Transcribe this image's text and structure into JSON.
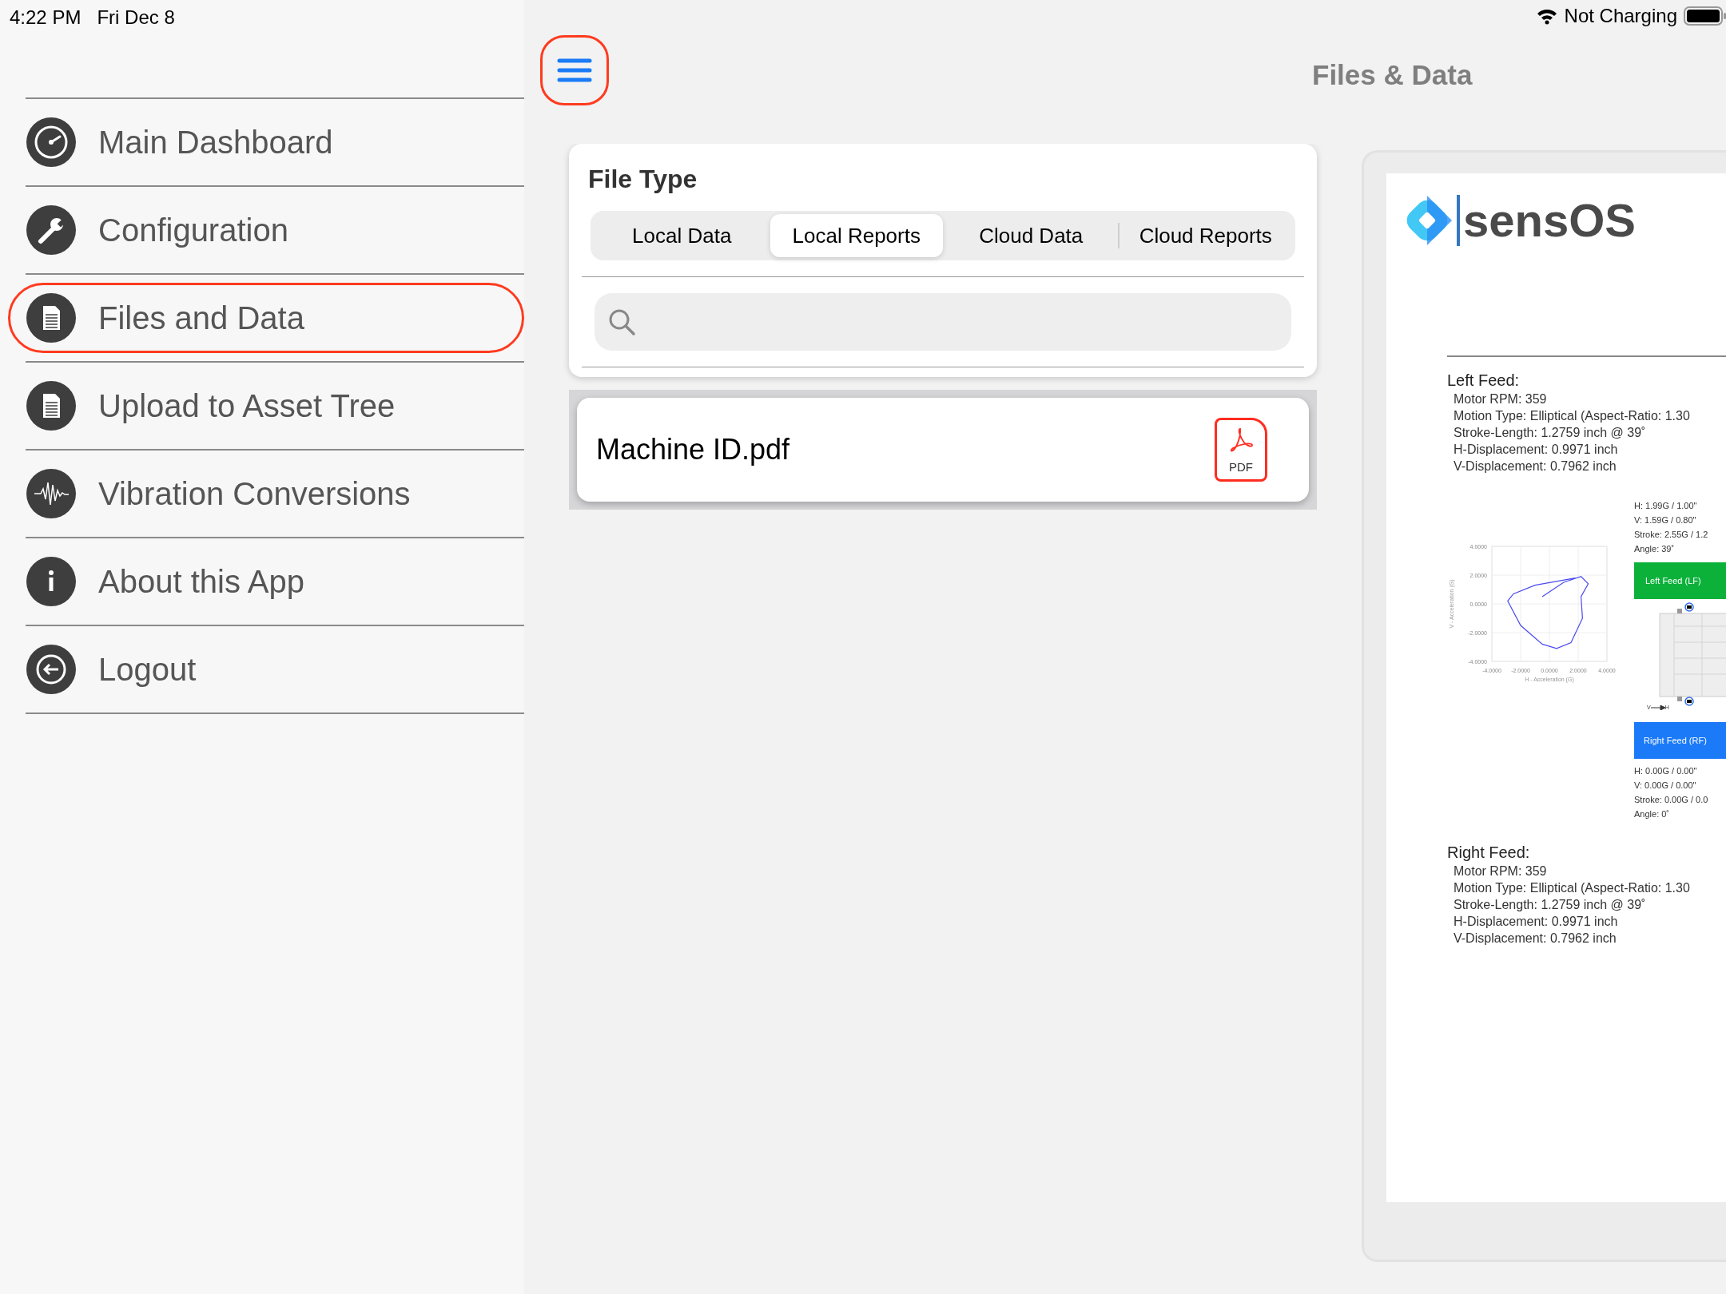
{
  "status_bar": {
    "time": "4:22 PM",
    "date": "Fri Dec 8",
    "battery_text": "Not Charging"
  },
  "sidebar": {
    "items": [
      {
        "label": "Main Dashboard",
        "kind": "gauge",
        "selected": false
      },
      {
        "label": "Configuration",
        "kind": "wrench",
        "selected": false
      },
      {
        "label": "Files and Data",
        "kind": "file",
        "selected": true
      },
      {
        "label": "Upload to Asset Tree",
        "kind": "file",
        "selected": false
      },
      {
        "label": "Vibration Conversions",
        "kind": "wave",
        "selected": false
      },
      {
        "label": "About this App",
        "kind": "info",
        "selected": false
      },
      {
        "label": "Logout",
        "kind": "logout",
        "selected": false
      }
    ]
  },
  "header": {
    "menu_button": {
      "highlighted": true
    },
    "title": "Files & Data"
  },
  "file_type": {
    "title": "File Type",
    "tabs": [
      {
        "label": "Local Data",
        "selected": false
      },
      {
        "label": "Local Reports",
        "selected": true
      },
      {
        "label": "Cloud Data",
        "selected": false
      },
      {
        "label": "Cloud Reports",
        "selected": false
      }
    ]
  },
  "files": [
    {
      "name": "Machine ID.pdf",
      "type_label": "PDF"
    }
  ],
  "preview": {
    "logo_text": "sensOS",
    "left_feed": {
      "heading": "Left Feed:",
      "lines": [
        "Motor RPM: 359",
        "Motion Type: Elliptical (Aspect-Ratio: 1.30",
        "Stroke-Length: 1.2759 inch @ 39˚",
        "H-Displacement: 0.9971 inch",
        "V-Displacement: 0.7962 inch"
      ]
    },
    "chart_data": {
      "type": "line",
      "xlabel": "H - Acceleration (G)",
      "ylabel": "V - Acceleration (G)",
      "x": [
        -0.5,
        1,
        2.2,
        2.7,
        2.2,
        2.3,
        1.5,
        0.5,
        -0.5,
        -2,
        -2.9,
        -2.5,
        -1,
        1.8
      ],
      "grid": true,
      "series": [
        {
          "color": "#4a4af0",
          "values": [
            0.5,
            1.5,
            1.9,
            1.4,
            0.5,
            -1,
            -2.7,
            -3.1,
            -2.8,
            -1.5,
            0.2,
            0.7,
            1.3,
            1.8
          ]
        }
      ],
      "xlim": [
        -4,
        4
      ],
      "ylim": [
        -4,
        4
      ],
      "xticks": [
        {
          "value": -4,
          "label": "-4.0000"
        },
        {
          "value": -2,
          "label": "-2.0000"
        },
        {
          "value": 0,
          "label": "0.0000"
        },
        {
          "value": 2,
          "label": "2.0000"
        },
        {
          "value": 4,
          "label": "4.0000"
        }
      ],
      "yticks": [
        {
          "value": -4,
          "label": "-4.0000"
        },
        {
          "value": -2,
          "label": "-2.0000"
        },
        {
          "value": 0,
          "label": "0.0000"
        },
        {
          "value": 2,
          "label": "2.0000"
        },
        {
          "value": 4,
          "label": "4.0000"
        }
      ]
    },
    "left_stats": [
      "H: 1.99G / 1.00\"",
      "V: 1.59G / 0.80\"",
      "Stroke: 2.55G / 1.2",
      "Angle: 39˚"
    ],
    "left_label": "Left Feed (LF)",
    "axis_labels": [
      "V",
      "H"
    ],
    "right_label": "Right Feed (RF)",
    "right_stats": [
      "H: 0.00G / 0.00\"",
      "V: 0.00G / 0.00\"",
      "Stroke: 0.00G / 0.0",
      "Angle: 0˚"
    ],
    "right_feed": {
      "heading": "Right Feed:",
      "lines": [
        "Motor RPM: 359",
        "Motion Type: Elliptical (Aspect-Ratio: 1.30",
        "Stroke-Length: 1.2759 inch @ 39˚",
        "H-Displacement: 0.9971 inch",
        "V-Displacement: 0.7962 inch"
      ]
    }
  }
}
